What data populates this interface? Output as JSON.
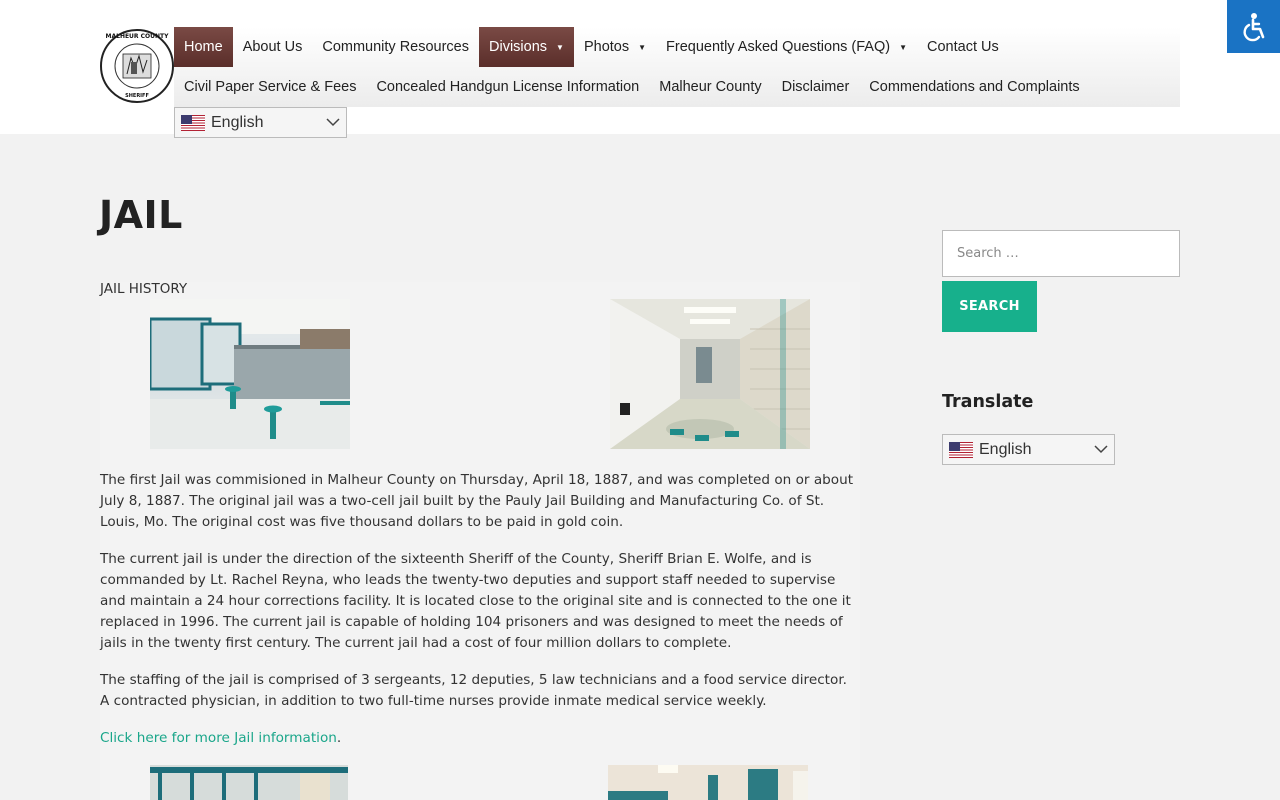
{
  "header": {
    "logo": {
      "ring_text_top": "MALHEUR COUNTY",
      "ring_text_bottom": "SHERIFF",
      "alt": "Malheur County Sheriff badge"
    },
    "nav_row1": [
      {
        "label": "Home",
        "active": true,
        "has_dropdown": false
      },
      {
        "label": "About Us",
        "active": false,
        "has_dropdown": false
      },
      {
        "label": "Community Resources",
        "active": false,
        "has_dropdown": false
      },
      {
        "label": "Divisions",
        "active": true,
        "has_dropdown": true
      },
      {
        "label": "Photos",
        "active": false,
        "has_dropdown": true
      },
      {
        "label": "Frequently Asked Questions (FAQ)",
        "active": false,
        "has_dropdown": true
      },
      {
        "label": "Contact Us",
        "active": false,
        "has_dropdown": false
      }
    ],
    "nav_row2": [
      {
        "label": "Civil Paper Service & Fees"
      },
      {
        "label": "Concealed Handgun License Information"
      },
      {
        "label": "Malheur County"
      },
      {
        "label": "Disclaimer"
      },
      {
        "label": "Commendations and Complaints"
      }
    ],
    "language": {
      "selected": "English",
      "flag_icon": "us-flag-icon"
    },
    "caret_glyph": "▼",
    "accessibility_icon": "wheelchair-icon"
  },
  "main": {
    "title": "JAIL",
    "section_label": "JAIL HISTORY",
    "paragraphs": [
      "The first Jail was commisioned in Malheur County on Thursday, April 18, 1887, and was completed on or about July 8, 1887.  The original jail was a two-cell jail built by the Pauly Jail Building and Manufacturing Co. of St. Louis, Mo.  The original cost was five thousand dollars to be paid in gold coin.",
      "The current jail is under the direction of the sixteenth Sheriff of the County, Sheriff Brian E. Wolfe, and is commanded by Lt. Rachel Reyna, who leads the twenty-two deputies and support staff needed to supervise and maintain a 24 hour corrections facility.  It is located close to the original site and is connected to the one it replaced in 1996.  The current jail is capable of holding 104 prisoners and was designed to meet the needs of jails in the twenty first century.  The current jail had a cost of four million dollars to complete.",
      "The staffing of the jail is comprised of 3 sergeants, 12 deputies, 5 law technicians and a food service director. A contracted physician, in addition to two full-time nurses provide inmate medical service weekly."
    ],
    "link_text": "Click here for more Jail information",
    "link_suffix": "."
  },
  "sidebar": {
    "search_placeholder": "Search …",
    "search_button": "SEARCH",
    "translate_title": "Translate",
    "language": {
      "selected": "English",
      "flag_icon": "us-flag-icon"
    }
  },
  "colors": {
    "accent_green": "#17b08c",
    "nav_active": "#6a3b36",
    "accessibility_blue": "#1a73c4",
    "link": "#1aa68a"
  }
}
